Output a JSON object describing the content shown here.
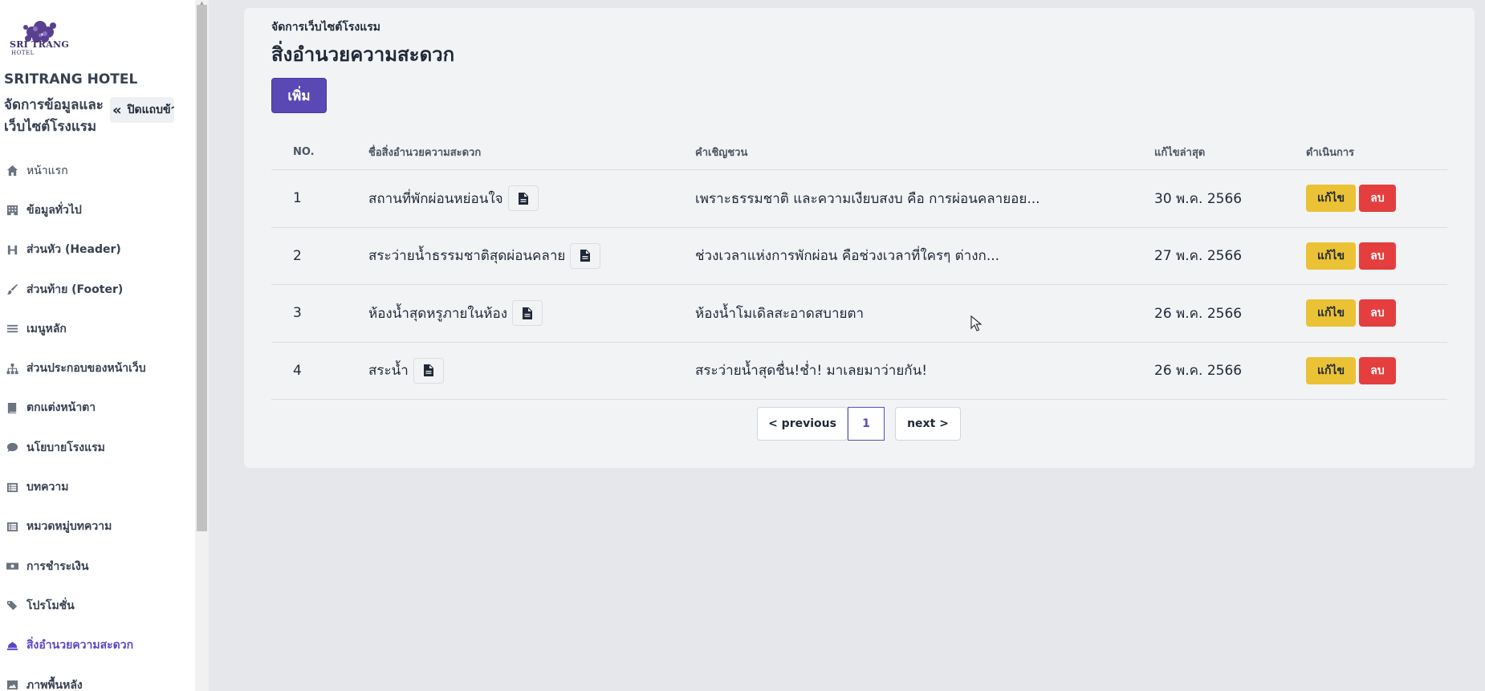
{
  "sidebar": {
    "logo_text": "SRI TRANG",
    "logo_sub": "HOTEL",
    "hotel_name": "SRITRANG HOTEL",
    "description": "จัดการข้อมูลและเว็บไซต์โรงแรม",
    "collapse_label": "ปิดแถบข้า",
    "items": [
      {
        "label": "หน้าแรก",
        "icon": "home-icon"
      },
      {
        "label": "ข้อมูลทั่วไป",
        "icon": "building-icon"
      },
      {
        "label": "ส่วนหัว (Header)",
        "icon": "heading-icon"
      },
      {
        "label": "ส่วนท้าย (Footer)",
        "icon": "brush-icon"
      },
      {
        "label": "เมนูหลัก",
        "icon": "menu-bars-icon"
      },
      {
        "label": "ส่วนประกอบของหน้าเว็บ",
        "icon": "sitemap-icon"
      },
      {
        "label": "ตกแต่งหน้าตา",
        "icon": "book-icon"
      },
      {
        "label": "นโยบายโรงแรม",
        "icon": "comment-icon"
      },
      {
        "label": "บทความ",
        "icon": "list-icon"
      },
      {
        "label": "หมวดหมู่บทความ",
        "icon": "list-icon"
      },
      {
        "label": "การชำระเงิน",
        "icon": "money-icon"
      },
      {
        "label": "โปรโมชั่น",
        "icon": "tags-icon"
      },
      {
        "label": "สิ่งอำนวยความสะดวก",
        "icon": "bell-icon",
        "active": true
      },
      {
        "label": "ภาพพื้นหลัง",
        "icon": "image-icon"
      }
    ]
  },
  "main": {
    "breadcrumb": "จัดการเว็บไซต์โรงแรม",
    "title": "สิ่งอำนวยความสะดวก",
    "add_label": "เพิ่ม",
    "table": {
      "headers": {
        "no": "NO.",
        "name": "ชื่อสิ่งอำนวยความสะดวก",
        "invite": "คำเชิญชวน",
        "updated": "แก้ไขล่าสุด",
        "actions": "ดำเนินการ"
      },
      "rows": [
        {
          "no": "1",
          "name": "สถานที่พักผ่อนหย่อนใจ",
          "invite": "เพราะธรรมชาติ และความเงียบสงบ คือ การผ่อนคลายอย...",
          "updated": "30 พ.ค. 2566",
          "edit": "แก้ไข",
          "delete": "ลบ"
        },
        {
          "no": "2",
          "name": "สระว่ายน้ำธรรมชาติสุดผ่อนคลาย",
          "invite": "ช่วงเวลาแห่งการพักผ่อน คือช่วงเวลาที่ใครๆ ต่างก...",
          "updated": "27 พ.ค. 2566",
          "edit": "แก้ไข",
          "delete": "ลบ"
        },
        {
          "no": "3",
          "name": "ห้องน้ำสุดหรูภายในห้อง",
          "invite": "ห้องน้ำโมเดิลสะอาดสบายตา",
          "updated": "26 พ.ค. 2566",
          "edit": "แก้ไข",
          "delete": "ลบ"
        },
        {
          "no": "4",
          "name": "สระน้ำ",
          "invite": "สระว่ายน้ำสุดชื่น!ช่ำ! มาเลยมาว่ายกัน!",
          "updated": "26 พ.ค. 2566",
          "edit": "แก้ไข",
          "delete": "ลบ"
        }
      ]
    },
    "pagination": {
      "prev": "< previous",
      "current": "1",
      "next": "next >"
    }
  },
  "colors": {
    "accent": "#5b47c9",
    "add_button": "#5a48b5",
    "edit_button": "#ebc236",
    "delete_button": "#e53e3e"
  }
}
